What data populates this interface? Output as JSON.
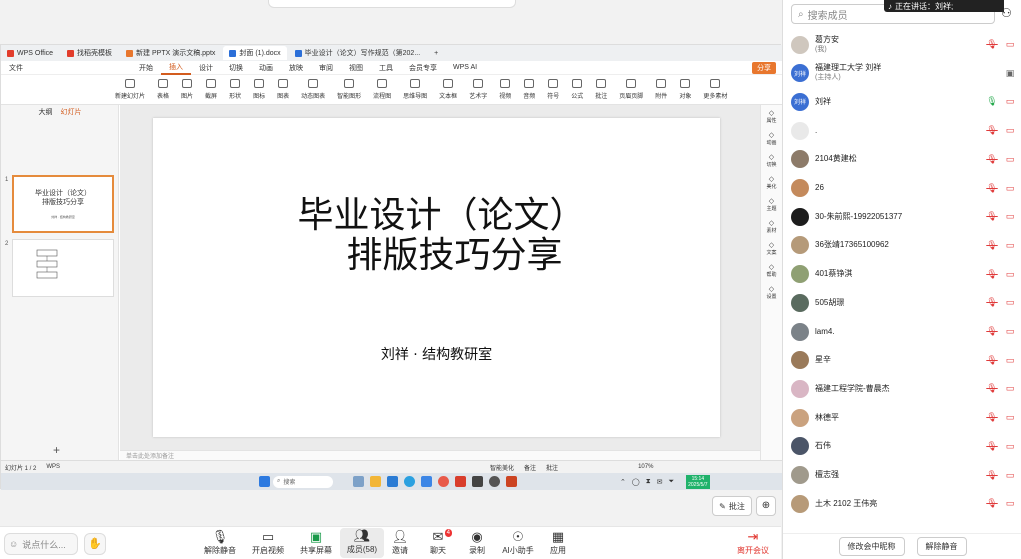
{
  "meeting": {
    "speaking_label": "正在讲话：刘祥;",
    "bottom": {
      "chat_placeholder": "说点什么...",
      "mute_label": "解除静音",
      "video_label": "开启视频",
      "share_label": "共享屏幕",
      "members_label": "成员(58)",
      "invite_label": "邀请",
      "chat_label": "聊天",
      "chat_badge": "4",
      "record_label": "录制",
      "ai_label": "AI小助手",
      "apps_label": "应用",
      "leave_label": "离开会议"
    },
    "annotate_label": "批注"
  },
  "wps": {
    "tabs": [
      {
        "label": "WPS Office",
        "color": "#e23d2c"
      },
      {
        "label": "找稻壳模板",
        "color": "#e23d2c"
      },
      {
        "label": "新建 PPTX 演示文稿.pptx",
        "color": "#e8772e"
      },
      {
        "label": "封面 (1).docx",
        "color": "#2b6fd8"
      },
      {
        "label": "毕业设计（论文）写作规范（第202...",
        "color": "#2b6fd8"
      }
    ],
    "menus": [
      "开始",
      "插入",
      "设计",
      "切换",
      "动画",
      "放映",
      "审阅",
      "视图",
      "工具",
      "会员专享",
      "WPS AI"
    ],
    "active_menu": "插入",
    "file_menu": "文件",
    "share_btn": "分享",
    "ribbon": [
      "新建幻灯片",
      "表格",
      "图片",
      "截屏",
      "形状",
      "图标",
      "图表",
      "动态图表",
      "智能图形",
      "流程图",
      "思维导图",
      "文本框",
      "艺术字",
      "视频",
      "音频",
      "符号",
      "公式",
      "批注",
      "页眉页脚",
      "附件",
      "对象",
      "更多素材"
    ],
    "thumb_tabs": [
      "大纲",
      "幻灯片"
    ],
    "thumb1_title": "毕业设计（论文）\n排版技巧分享",
    "thumb1_sub": "刘祥 · 结构教研室",
    "slide_title_line1": "毕业设计（论文）",
    "slide_title_line2": "排版技巧分享",
    "slide_subtitle": "刘祥 · 结构教研室",
    "notes_placeholder": "单击此处添加备注",
    "right_pane": [
      "属性",
      "动画",
      "切换",
      "美化",
      "主题",
      "素材",
      "文案",
      "帮助",
      "设置"
    ],
    "status": {
      "slide_count": "幻灯片 1 / 2",
      "app": "WPS",
      "beautify": "智能美化",
      "notes": "备注",
      "comment": "批注",
      "zoom": "107%"
    },
    "taskbar": {
      "search": "搜索",
      "clock_time": "15:14",
      "clock_date": "2025/5/7"
    }
  },
  "members_panel": {
    "search_placeholder": "搜索成员",
    "members": [
      {
        "name": "葛方安",
        "sub": "(我)",
        "avatar": "photo",
        "color": "#cfc7be",
        "mic": "off",
        "cam": "off"
      },
      {
        "name": "福建理工大学 刘祥",
        "sub": "(主持人)",
        "avatar": "刘祥",
        "color": "#3b6fd3",
        "mic": "none",
        "cam": "screen"
      },
      {
        "name": "刘祥",
        "sub": "",
        "avatar": "刘祥",
        "color": "#3b6fd3",
        "mic": "on",
        "cam": "off"
      },
      {
        "name": ".",
        "sub": "",
        "avatar": "photo",
        "color": "#e9e9e9",
        "mic": "off",
        "cam": "off"
      },
      {
        "name": "2104黄建松",
        "sub": "",
        "avatar": "photo",
        "color": "#8d7b69",
        "mic": "off",
        "cam": "off"
      },
      {
        "name": "26",
        "sub": "",
        "avatar": "photo",
        "color": "#c48a5c",
        "mic": "off",
        "cam": "off"
      },
      {
        "name": "30-朱前熙-19922051377",
        "sub": "",
        "avatar": "photo",
        "color": "#1c1c1c",
        "mic": "off",
        "cam": "off"
      },
      {
        "name": "36张靖17365100962",
        "sub": "",
        "avatar": "photo",
        "color": "#b59a79",
        "mic": "off",
        "cam": "off"
      },
      {
        "name": "401蔡铮淇",
        "sub": "",
        "avatar": "photo",
        "color": "#8fa073",
        "mic": "off",
        "cam": "off"
      },
      {
        "name": "505胡璟",
        "sub": "",
        "avatar": "photo",
        "color": "#5a6b5f",
        "mic": "off",
        "cam": "off"
      },
      {
        "name": "lam4.",
        "sub": "",
        "avatar": "photo",
        "color": "#7b8288",
        "mic": "off",
        "cam": "off"
      },
      {
        "name": "星辛",
        "sub": "",
        "avatar": "photo",
        "color": "#9a7a5a",
        "mic": "off",
        "cam": "off"
      },
      {
        "name": "福建工程学院-曹晨杰",
        "sub": "",
        "avatar": "photo",
        "color": "#d9b6c4",
        "mic": "off",
        "cam": "off"
      },
      {
        "name": "林德平",
        "sub": "",
        "avatar": "photo",
        "color": "#caa27f",
        "mic": "off",
        "cam": "off"
      },
      {
        "name": "石伟",
        "sub": "",
        "avatar": "photo",
        "color": "#4b5568",
        "mic": "off",
        "cam": "off"
      },
      {
        "name": "檀志强",
        "sub": "",
        "avatar": "photo",
        "color": "#a09a8c",
        "mic": "off",
        "cam": "off"
      },
      {
        "name": "土木 2102 王伟亮",
        "sub": "",
        "avatar": "photo",
        "color": "#b79a78",
        "mic": "off",
        "cam": "off"
      }
    ],
    "rename_btn": "修改会中昵称",
    "unmute_btn": "解除静音"
  }
}
